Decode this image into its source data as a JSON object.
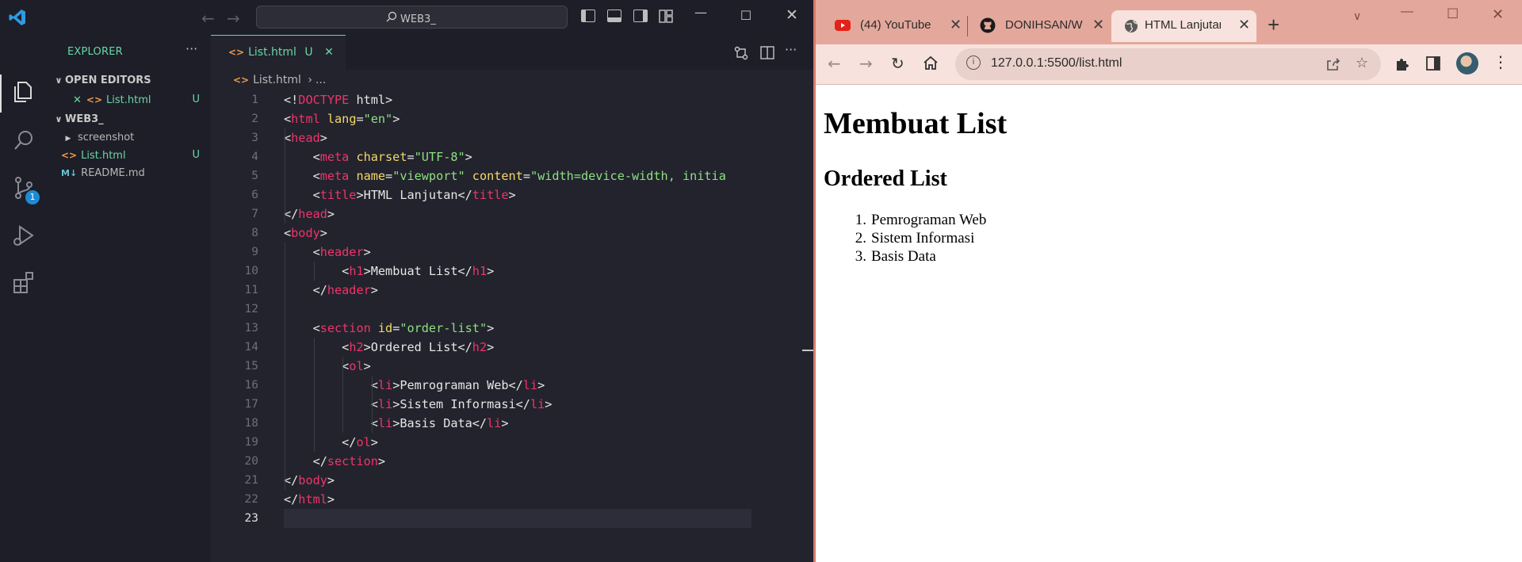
{
  "vscode": {
    "command_center": "WEB3_",
    "sidebar": {
      "title": "EXPLORER",
      "more": "···",
      "open_editors_label": "OPEN EDITORS",
      "open_editors": [
        {
          "name": "List.html",
          "status": "U"
        }
      ],
      "workspace_label": "WEB3_",
      "files": [
        {
          "name": "screenshot",
          "type": "folder"
        },
        {
          "name": "List.html",
          "type": "html",
          "status": "U"
        },
        {
          "name": "README.md",
          "type": "markdown"
        }
      ]
    },
    "source_control_badge": "1",
    "tab": {
      "label": "List.html",
      "status": "U"
    },
    "breadcrumb": {
      "file": "List.html",
      "sep": "›",
      "rest": "..."
    },
    "code_lines": [
      "<!DOCTYPE html>",
      "<html lang=\"en\">",
      "<head>",
      "    <meta charset=\"UTF-8\">",
      "    <meta name=\"viewport\" content=\"width=device-width, initia",
      "    <title>HTML Lanjutan</title>",
      "</head>",
      "<body>",
      "    <header>",
      "        <h1>Membuat List</h1>",
      "    </header>",
      "",
      "    <section id=\"order-list\">",
      "        <h2>Ordered List</h2>",
      "        <ol>",
      "            <li>Pemrograman Web</li>",
      "            <li>Sistem Informasi</li>",
      "            <li>Basis Data</li>",
      "        </ol>",
      "    </section>",
      "</body>",
      "</html>",
      ""
    ],
    "active_line": 23,
    "colors": {
      "accent": "#6bd5a7",
      "tag": "#f0346a",
      "attr": "#f5d86a",
      "string": "#8ee082"
    }
  },
  "browser": {
    "tabs": [
      {
        "title": "(44) YouTube",
        "icon": "youtube-icon",
        "active": false
      },
      {
        "title": "DONIHSAN/W",
        "icon": "github-icon",
        "active": false
      },
      {
        "title": "HTML Lanjutan",
        "icon": "globe-icon",
        "active": true
      }
    ],
    "new_tab": "+",
    "url": "127.0.0.1:5500/list.html",
    "page": {
      "h1": "Membuat List",
      "h2": "Ordered List",
      "list": [
        "Pemrograman Web",
        "Sistem Informasi",
        "Basis Data"
      ]
    },
    "colors": {
      "frame": "#e3a89b",
      "toolbar": "#f7e2dd"
    }
  }
}
